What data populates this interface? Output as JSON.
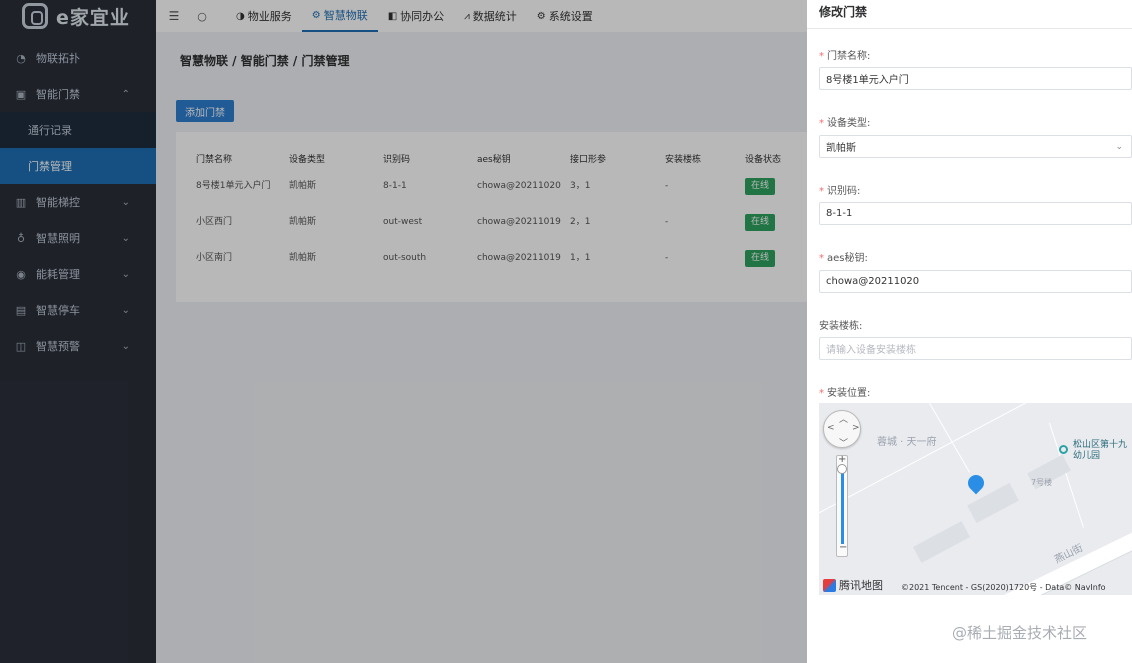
{
  "app": {
    "logo_text": "e家宜业"
  },
  "sidebar": {
    "items": [
      {
        "label": "物联拓扑",
        "icon": "dashboard-icon",
        "glyph": "◔"
      },
      {
        "label": "智能门禁",
        "icon": "door-icon",
        "glyph": "▣",
        "expanded": true
      },
      {
        "label": "通行记录",
        "sub": true
      },
      {
        "label": "门禁管理",
        "sub": true,
        "active": true
      },
      {
        "label": "智能梯控",
        "icon": "elevator-icon",
        "glyph": "▥"
      },
      {
        "label": "智慧照明",
        "icon": "bulb-icon",
        "glyph": "♁"
      },
      {
        "label": "能耗管理",
        "icon": "energy-icon",
        "glyph": "◉"
      },
      {
        "label": "智慧停车",
        "icon": "parking-icon",
        "glyph": "▤"
      },
      {
        "label": "智慧预警",
        "icon": "alert-icon",
        "glyph": "◫"
      }
    ]
  },
  "header": {
    "tabs": [
      {
        "label": "物业服务",
        "glyph": "◑"
      },
      {
        "label": "智慧物联",
        "glyph": "⚙",
        "active": true
      },
      {
        "label": "协同办公",
        "glyph": "◧"
      },
      {
        "label": "数据统计",
        "glyph": "⩘"
      },
      {
        "label": "系统设置",
        "glyph": "⚙"
      }
    ]
  },
  "main": {
    "breadcrumb": "智慧物联 / 智能门禁 / 门禁管理",
    "add_button": "添加门禁",
    "table": {
      "columns": [
        "门禁名称",
        "设备类型",
        "识别码",
        "aes秘钥",
        "接口形参",
        "安装楼栋",
        "设备状态"
      ],
      "rows": [
        [
          "8号楼1单元入户门",
          "凯帕斯",
          "8-1-1",
          "chowa@20211020",
          "3，1",
          "-",
          "在线"
        ],
        [
          "小区西门",
          "凯帕斯",
          "out-west",
          "chowa@20211019",
          "2，1",
          "-",
          "在线"
        ],
        [
          "小区南门",
          "凯帕斯",
          "out-south",
          "chowa@20211019",
          "1，1",
          "-",
          "在线"
        ]
      ]
    }
  },
  "drawer": {
    "title": "修改门禁",
    "fields": {
      "name": {
        "label": "门禁名称:",
        "value": "8号楼1单元入户门",
        "required": true
      },
      "type": {
        "label": "设备类型:",
        "value": "凯帕斯",
        "required": true
      },
      "code": {
        "label": "识别码:",
        "value": "8-1-1",
        "required": true
      },
      "aes": {
        "label": "aes秘钥:",
        "value": "chowa@20211020",
        "required": true
      },
      "building": {
        "label": "安装楼栋:",
        "placeholder": "请输入设备安装楼栋",
        "required": false
      },
      "location": {
        "label": "安装位置:",
        "required": true
      }
    },
    "map": {
      "label_community": "蓉城 · 天一府",
      "label_poi": "松山区第十九幼儿园",
      "label_building": "7号楼",
      "label_street": "燕山街",
      "logo": "腾讯地图",
      "copyright": "©2021 Tencent - GS(2020)1720号 - Data© NavInfo"
    }
  },
  "watermark": "@稀土掘金技术社区",
  "colors": {
    "accent": "#1f6fb5",
    "success": "#2fa360",
    "required": "#f56c6c"
  }
}
